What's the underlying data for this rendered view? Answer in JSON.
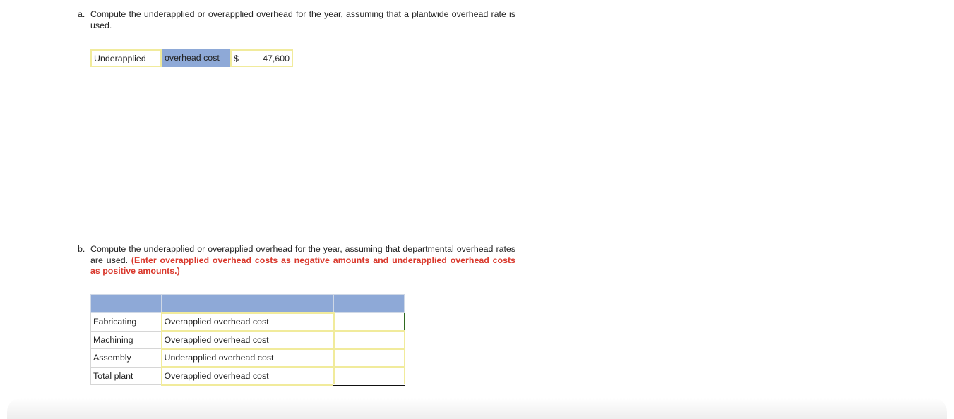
{
  "part_a": {
    "label": "a.",
    "question": "Compute the underapplied or overapplied overhead for the year, assuming that a plantwide overhead rate is used.",
    "answer": {
      "type": "Underapplied",
      "descriptor": "overhead cost",
      "currency": "$",
      "amount": "47,600"
    }
  },
  "part_b": {
    "label": "b.",
    "question": "Compute the underapplied or overapplied overhead for the year, assuming that departmental overhead rates are used.",
    "instruction": "(Enter overapplied overhead costs as negative amounts and underapplied overhead costs as positive amounts.)",
    "rows": [
      {
        "department": "Fabricating",
        "type": "Overapplied overhead cost",
        "amount": ""
      },
      {
        "department": "Machining",
        "type": "Overapplied overhead cost",
        "amount": ""
      },
      {
        "department": "Assembly",
        "type": "Underapplied overhead cost",
        "amount": ""
      },
      {
        "department": "Total plant",
        "type": "Overapplied overhead cost",
        "amount": ""
      }
    ]
  },
  "colors": {
    "header_blue": "#8ea9d7",
    "input_border_yellow": "#f1eb9c",
    "instruction_red": "#d9382c"
  }
}
